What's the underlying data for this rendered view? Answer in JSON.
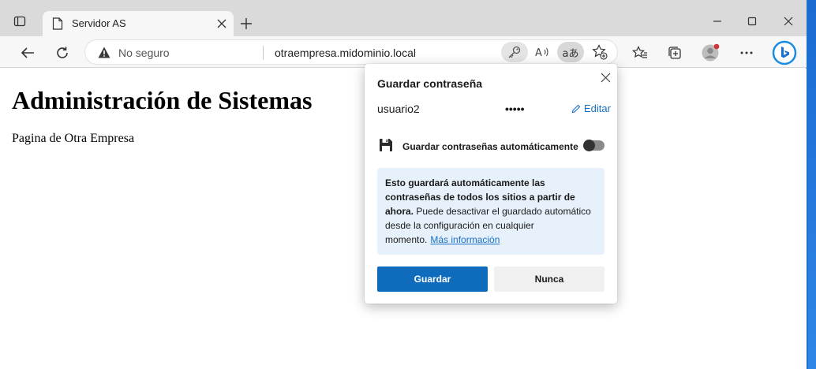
{
  "tab": {
    "title": "Servidor AS"
  },
  "toolbar": {
    "not_secure": "No seguro",
    "url": "otraempresa.midominio.local",
    "translate_glyph": "aあ"
  },
  "page": {
    "heading": "Administración de Sistemas",
    "paragraph": "Pagina de Otra Empresa"
  },
  "popup": {
    "title": "Guardar contraseña",
    "username": "usuario2",
    "password": "•••••",
    "edit_label": "Editar",
    "auto_save_label": "Guardar contraseñas automáticamente",
    "auto_save_enabled": false,
    "info_bold": "Esto guardará automáticamente las contraseñas de todos los sitios a partir de ahora.",
    "info_rest": " Puede desactivar el guardado automático desde la configuración en cualquier momento.",
    "info_link": "Más información",
    "save_button": "Guardar",
    "never_button": "Nunca"
  },
  "colors": {
    "accent": "#0f6cbd",
    "info_bg": "#e6f1fb",
    "notification_dot": "#d13438"
  }
}
